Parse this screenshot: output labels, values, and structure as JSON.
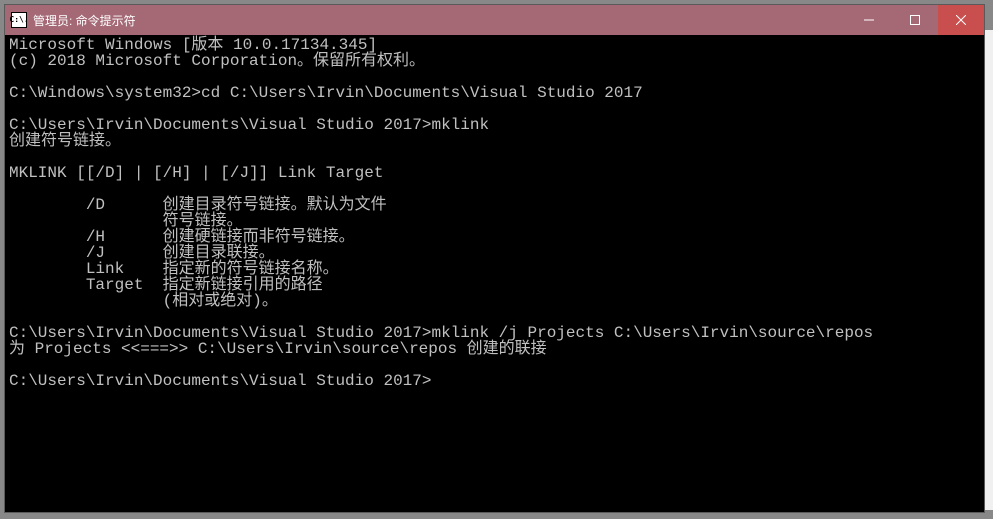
{
  "titlebar": {
    "icon_label": "C:\\.",
    "title": "管理员: 命令提示符"
  },
  "terminal": {
    "lines": [
      "Microsoft Windows [版本 10.0.17134.345]",
      "(c) 2018 Microsoft Corporation。保留所有权利。",
      "",
      "C:\\Windows\\system32>cd C:\\Users\\Irvin\\Documents\\Visual Studio 2017",
      "",
      "C:\\Users\\Irvin\\Documents\\Visual Studio 2017>mklink",
      "创建符号链接。",
      "",
      "MKLINK [[/D] | [/H] | [/J]] Link Target",
      "",
      "        /D      创建目录符号链接。默认为文件",
      "                符号链接。",
      "        /H      创建硬链接而非符号链接。",
      "        /J      创建目录联接。",
      "        Link    指定新的符号链接名称。",
      "        Target  指定新链接引用的路径",
      "                (相对或绝对)。",
      "",
      "C:\\Users\\Irvin\\Documents\\Visual Studio 2017>mklink /j Projects C:\\Users\\Irvin\\source\\repos",
      "为 Projects <<===>> C:\\Users\\Irvin\\source\\repos 创建的联接",
      "",
      "C:\\Users\\Irvin\\Documents\\Visual Studio 2017>"
    ]
  }
}
